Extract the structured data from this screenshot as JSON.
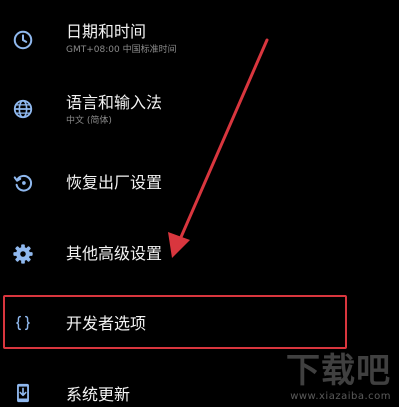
{
  "settings": {
    "items": [
      {
        "icon": "clock-icon",
        "title": "日期和时间",
        "subtitle": "GMT+08:00 中国标准时间"
      },
      {
        "icon": "globe-icon",
        "title": "语言和输入法",
        "subtitle": "中文 (简体)"
      },
      {
        "icon": "restore-icon",
        "title": "恢复出厂设置"
      },
      {
        "icon": "gear-icon",
        "title": "其他高级设置"
      },
      {
        "icon": "code-braces-icon",
        "title": "开发者选项"
      },
      {
        "icon": "system-update-icon",
        "title": "系统更新"
      }
    ]
  },
  "colors": {
    "background": "#000000",
    "icon": "#8fb8ee",
    "title": "#f2f2f2",
    "subtitle": "#8a8a8a",
    "annotation": "#d9363e"
  },
  "watermark": {
    "logo": "下载吧",
    "url": "www.xiazaiba.com"
  }
}
